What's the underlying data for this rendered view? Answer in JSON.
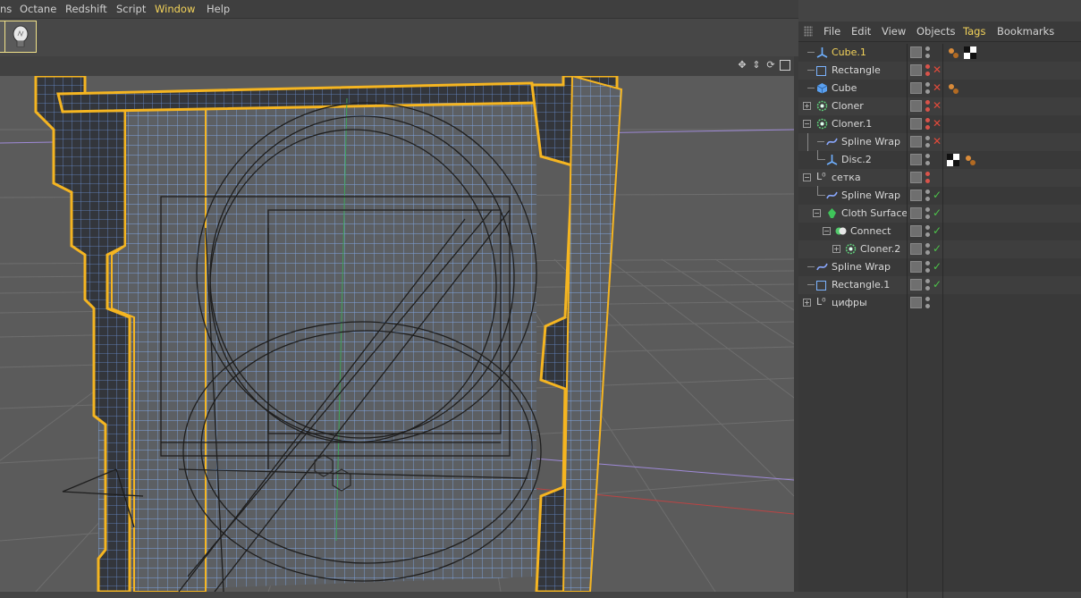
{
  "menubar": {
    "items": [
      "ns",
      "Octane",
      "Redshift",
      "Script",
      "Window",
      "Help"
    ],
    "highlight_index": 4
  },
  "toolbar": {
    "buttons": [
      "light-object-button"
    ]
  },
  "viewport": {
    "nav_icons": [
      "move-view-icon",
      "vertical-move-icon",
      "rotate-view-icon",
      "maximize-view-icon"
    ]
  },
  "object_manager": {
    "menu": [
      "File",
      "Edit",
      "View",
      "Objects",
      "Tags",
      "Bookmarks"
    ],
    "menu_highlight_index": 4,
    "rows": [
      {
        "label": "Cube.1",
        "selected": true,
        "status": "none",
        "dots": [
          "#9a9a9a",
          "#9a9a9a"
        ]
      },
      {
        "label": "Rectangle",
        "status": "x",
        "dots": [
          "#d9534a",
          "#d9534a"
        ]
      },
      {
        "label": "Cube",
        "status": "x",
        "dots": [
          "#9a9a9a",
          "#9a9a9a"
        ]
      },
      {
        "label": "Cloner",
        "status": "x",
        "dots": [
          "#d9534a",
          "#d9534a"
        ]
      },
      {
        "label": "Cloner.1",
        "status": "x",
        "dots": [
          "#d9534a",
          "#d9534a"
        ]
      },
      {
        "label": "Spline Wrap",
        "status": "x",
        "dots": [
          "#9a9a9a",
          "#9a9a9a"
        ]
      },
      {
        "label": "Disc.2",
        "status": "none",
        "dots": [
          "#9a9a9a",
          "#9a9a9a"
        ]
      },
      {
        "label": "сетка",
        "status": "none",
        "dots": [
          "#d9534a",
          "#d9534a"
        ]
      },
      {
        "label": "Spline Wrap",
        "status": "check",
        "dots": [
          "#9a9a9a",
          "#9a9a9a"
        ]
      },
      {
        "label": "Cloth Surface",
        "status": "check",
        "dots": [
          "#9a9a9a",
          "#9a9a9a"
        ]
      },
      {
        "label": "Connect",
        "status": "check",
        "dots": [
          "#9a9a9a",
          "#9a9a9a"
        ]
      },
      {
        "label": "Cloner.2",
        "status": "check",
        "dots": [
          "#9a9a9a",
          "#9a9a9a"
        ]
      },
      {
        "label": "Spline Wrap",
        "status": "check",
        "dots": [
          "#9a9a9a",
          "#9a9a9a"
        ]
      },
      {
        "label": "Rectangle.1",
        "status": "check",
        "dots": [
          "#9a9a9a",
          "#9a9a9a"
        ]
      },
      {
        "label": "цифры",
        "status": "none",
        "dots": [
          "#9a9a9a",
          "#9a9a9a"
        ]
      }
    ]
  }
}
